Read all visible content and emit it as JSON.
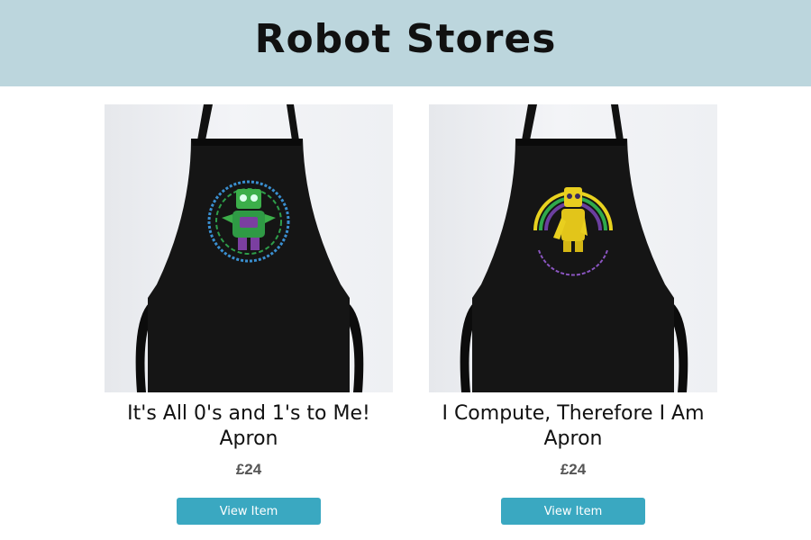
{
  "header": {
    "title": "Robot Stores",
    "background": "#bcd6dd"
  },
  "products": [
    {
      "name": "It's All 0's and 1's to Me! Apron",
      "price": "£24",
      "button_label": "View Item",
      "image_alt": "Black apron with green robot graphic",
      "icon": "robot-apron-graphic",
      "accent": "#3aa8c1"
    },
    {
      "name": "I Compute, Therefore I Am Apron",
      "price": "£24",
      "button_label": "View Item",
      "image_alt": "Black apron with yellow robot graphic",
      "icon": "robot-apron-graphic",
      "accent": "#3aa8c1"
    }
  ]
}
